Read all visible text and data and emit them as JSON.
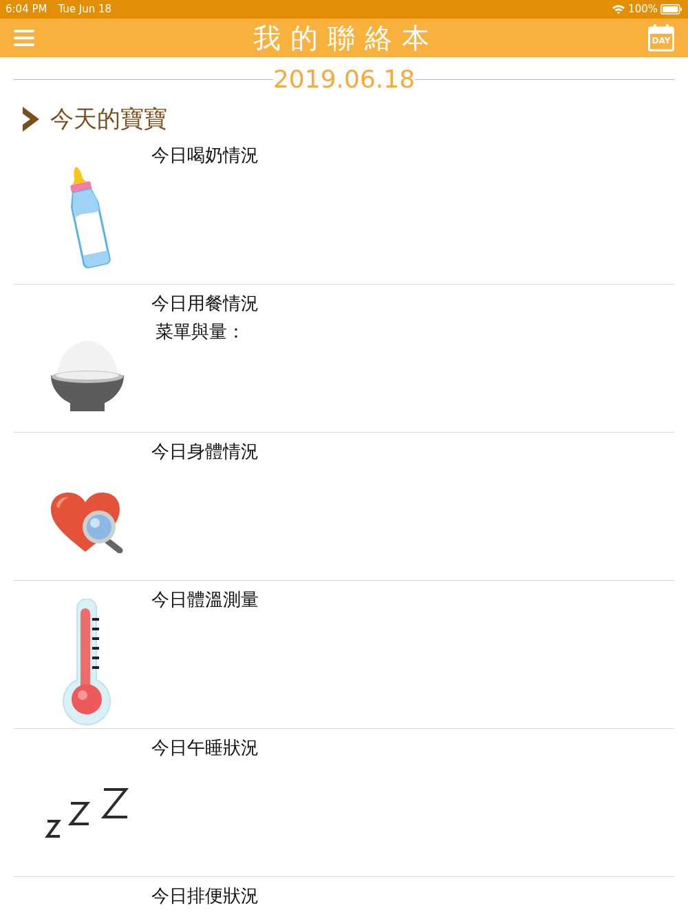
{
  "status_bar": {
    "time": "6:04 PM",
    "date": "Tue Jun 18",
    "battery": "100%"
  },
  "header": {
    "title": "我的聯絡本",
    "calendar_label": "DAY"
  },
  "date": "2019.06.18",
  "section": {
    "title": "今天的寶寶"
  },
  "entries": [
    {
      "kind": "bottle",
      "title": "今日喝奶情況"
    },
    {
      "kind": "bowl",
      "title": "今日用餐情況",
      "subtitle": "菜單與量："
    },
    {
      "kind": "heart",
      "title": "今日身體情況"
    },
    {
      "kind": "thermometer",
      "title": "今日體溫測量"
    },
    {
      "kind": "sleep",
      "title": "今日午睡狀況"
    },
    {
      "title": "今日排便狀況"
    }
  ]
}
